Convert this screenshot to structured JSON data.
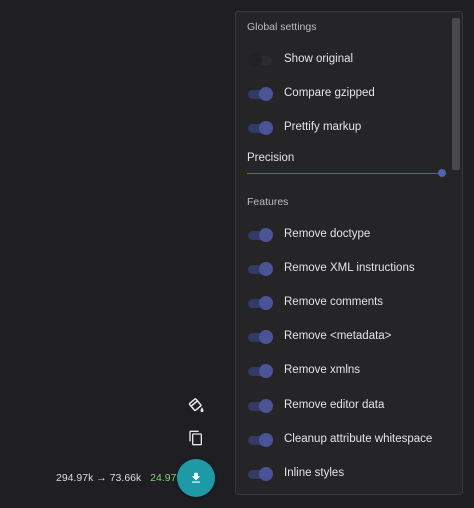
{
  "global_settings": {
    "title": "Global settings",
    "items": [
      {
        "label": "Show original",
        "on": false
      },
      {
        "label": "Compare gzipped",
        "on": true
      },
      {
        "label": "Prettify markup",
        "on": true
      }
    ],
    "precision_label": "Precision",
    "precision_value": 1.0
  },
  "features": {
    "title": "Features",
    "items": [
      {
        "label": "Remove doctype",
        "on": true
      },
      {
        "label": "Remove XML instructions",
        "on": true
      },
      {
        "label": "Remove comments",
        "on": true
      },
      {
        "label": "Remove <metadata>",
        "on": true
      },
      {
        "label": "Remove xmlns",
        "on": true
      },
      {
        "label": "Remove editor data",
        "on": true
      },
      {
        "label": "Cleanup attribute whitespace",
        "on": true
      },
      {
        "label": "Inline styles",
        "on": true
      }
    ]
  },
  "stats": {
    "original_size": "294.97k",
    "arrow": "→",
    "optimized_size": "73.66k",
    "percent": "24.97%"
  },
  "colors": {
    "background": "#1f1f23",
    "panel": "#252528",
    "toggle_on": "#4a5395",
    "fab": "#1e99a6",
    "percent": "#7fcf6f"
  },
  "icons": {
    "paint": "paint-bucket-icon",
    "copy": "copy-icon",
    "download": "download-icon"
  }
}
